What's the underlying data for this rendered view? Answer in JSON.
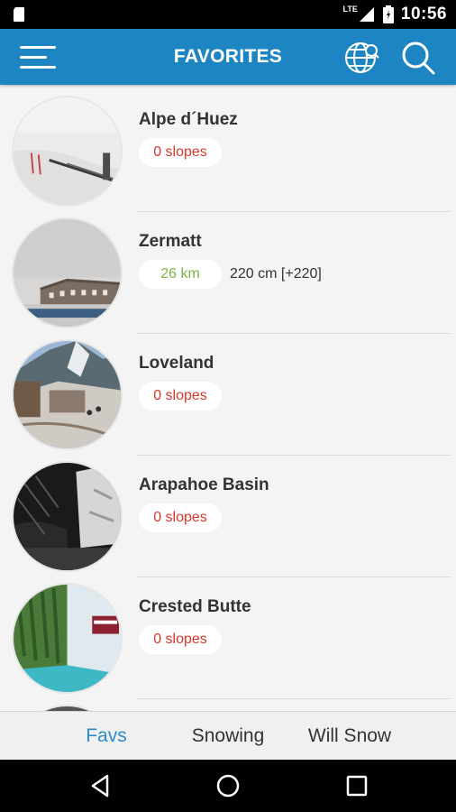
{
  "status_bar": {
    "time": "10:56",
    "network": "LTE"
  },
  "app_bar": {
    "title": "FAVORITES",
    "icons": [
      "menu-icon",
      "globe-search-icon",
      "search-icon"
    ]
  },
  "resorts": [
    {
      "name": "Alpe d´Huez",
      "badge": "0 slopes",
      "badge_color": "#d9372b",
      "extra": ""
    },
    {
      "name": "Zermatt",
      "badge": "26 km",
      "badge_color": "#7cb342",
      "extra": "220 cm [+220]"
    },
    {
      "name": "Loveland",
      "badge": "0 slopes",
      "badge_color": "#d9372b",
      "extra": ""
    },
    {
      "name": "Arapahoe Basin",
      "badge": "0 slopes",
      "badge_color": "#d9372b",
      "extra": ""
    },
    {
      "name": "Crested Butte",
      "badge": "0 slopes",
      "badge_color": "#d9372b",
      "extra": ""
    }
  ],
  "tabs": [
    {
      "label": "Favs",
      "active": true
    },
    {
      "label": "Snowing",
      "active": false
    },
    {
      "label": "Will Snow",
      "active": false
    }
  ],
  "colors": {
    "app_bar": "#1d86c2",
    "active_tab": "#2a8ccc",
    "badge_red": "#d9372b",
    "badge_green": "#7cb342"
  }
}
